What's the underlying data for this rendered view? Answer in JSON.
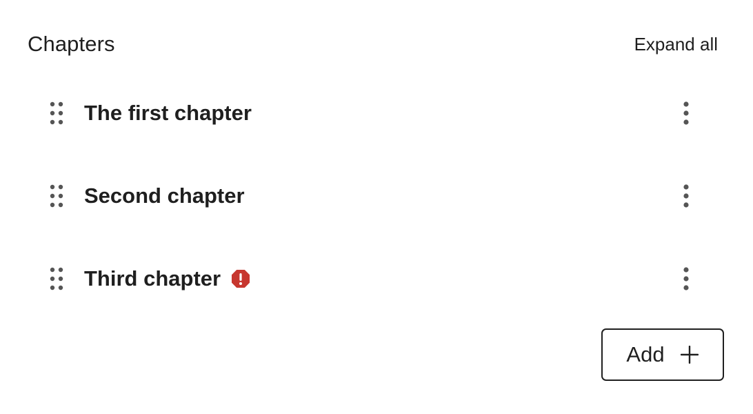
{
  "header": {
    "title": "Chapters",
    "expand_all_label": "Expand all"
  },
  "chapters": [
    {
      "title": "The first chapter",
      "has_error": false
    },
    {
      "title": "Second chapter",
      "has_error": false
    },
    {
      "title": "Third chapter",
      "has_error": true
    }
  ],
  "icons": {
    "drag": "drag-handle-icon",
    "more": "more-vertical-icon",
    "error": "error-octagon-icon",
    "add": "plus-icon"
  },
  "colors": {
    "text": "#1f1f1f",
    "icon": "#555555",
    "error": "#c7372f",
    "border": "#1f1f1f"
  },
  "add_button": {
    "label": "Add"
  }
}
